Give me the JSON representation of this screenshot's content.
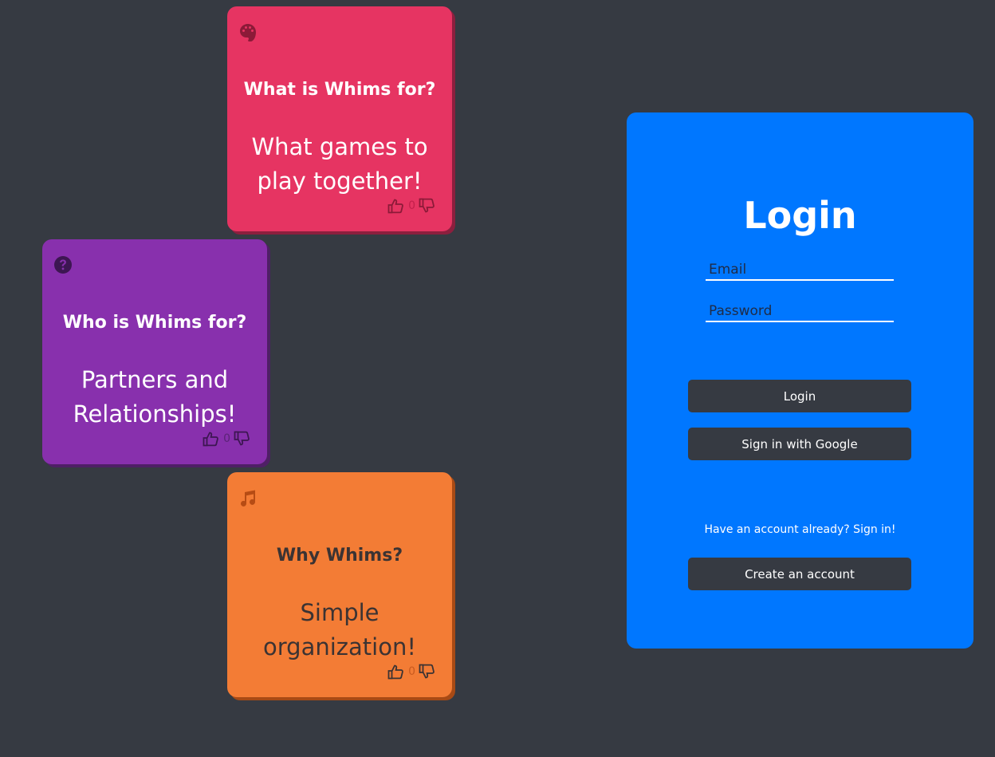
{
  "cards": [
    {
      "icon": "palette-icon",
      "title": "What is Whims for?",
      "body": "What games to play together!",
      "votes": "0",
      "color": "#e63462"
    },
    {
      "icon": "question-circle-icon",
      "title": "Who is Whims for?",
      "body": "Partners and Relationships!",
      "votes": "0",
      "color": "#8830ad"
    },
    {
      "icon": "music-note-icon",
      "title": "Why Whims?",
      "body": "Simple organization!",
      "votes": "0",
      "color": "#f37c35"
    }
  ],
  "login": {
    "title": "Login",
    "email_placeholder": "Email",
    "password_placeholder": "Password",
    "login_button": "Login",
    "google_button": "Sign in with Google",
    "signin_link": "Have an account already? Sign in!",
    "create_button": "Create an account",
    "accent": "#0077ff"
  },
  "colors": {
    "background": "#363a42",
    "button": "#363a42"
  }
}
